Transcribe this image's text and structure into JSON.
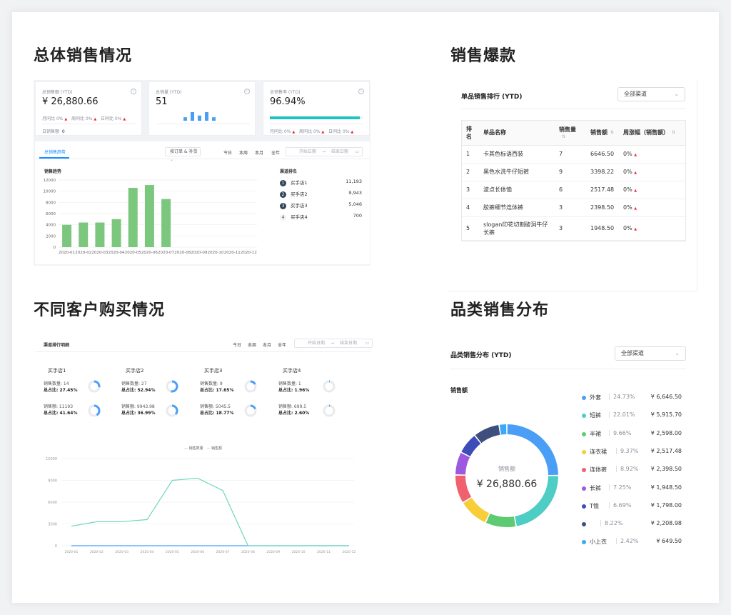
{
  "sections": {
    "overall": "总体销售情况",
    "hot": "销售爆款",
    "customer": "不同客户购买情况",
    "category": "品类销售分布"
  },
  "kpi": [
    {
      "label": "总销售额 (YTD)",
      "value": "¥ 26,880.66",
      "compare": [
        {
          "k": "月同比",
          "v": "0%"
        },
        {
          "k": "周同比",
          "v": "0%"
        },
        {
          "k": "日同比",
          "v": "0%"
        }
      ],
      "footer_label": "日销售额",
      "footer_value": "0"
    },
    {
      "label": "总销量 (YTD)",
      "value": "51",
      "bars": [
        2,
        5,
        3,
        5,
        2
      ],
      "footer_label": "",
      "footer_value": ""
    },
    {
      "label": "总销售率 (YTD)",
      "value": "96.94%",
      "progress": 0.9694,
      "compare": [
        {
          "k": "月同比",
          "v": "0%"
        },
        {
          "k": "周同比",
          "v": "0%"
        },
        {
          "k": "日同比",
          "v": "0%"
        }
      ]
    }
  ],
  "trend_panel": {
    "tab": "总销售趋势",
    "filter": "按订单 & 补货",
    "ranges": [
      "今日",
      "本周",
      "本月",
      "全年"
    ],
    "start_ph": "开始日期",
    "end_ph": "结束日期",
    "chart_title": "销售趋势",
    "ranking_title": "渠道排名",
    "ranking": [
      {
        "rank": "1",
        "name": "买手店1",
        "value": "11,193"
      },
      {
        "rank": "2",
        "name": "买手店2",
        "value": "9,943"
      },
      {
        "rank": "3",
        "name": "买手店3",
        "value": "5,046"
      },
      {
        "rank": "4",
        "name": "买手店4",
        "value": "700"
      }
    ]
  },
  "hot": {
    "title": "单品销售排行 (YTD)",
    "channel": "全部渠道",
    "headers": [
      "排名",
      "单品名称",
      "销售量",
      "销售额",
      "周涨幅（销售额）"
    ],
    "rows": [
      {
        "rank": "1",
        "name": "卡其色标语西装",
        "qty": "7",
        "amount": "6646.50",
        "change": "0%"
      },
      {
        "rank": "2",
        "name": "黑色水洗牛仔短裤",
        "qty": "9",
        "amount": "3398.22",
        "change": "0%"
      },
      {
        "rank": "3",
        "name": "波点长体恤",
        "qty": "6",
        "amount": "2517.48",
        "change": "0%"
      },
      {
        "rank": "4",
        "name": "胶裤细节连体裤",
        "qty": "3",
        "amount": "2398.50",
        "change": "0%"
      },
      {
        "rank": "5",
        "name": "slogan印花切割破洞牛仔长裤",
        "qty": "3",
        "amount": "1948.50",
        "change": "0%"
      }
    ]
  },
  "customer": {
    "title": "渠道排行明细",
    "ranges": [
      "今日",
      "本周",
      "本月",
      "全年"
    ],
    "start_ph": "开始日期",
    "end_ph": "结束日期",
    "stores": [
      {
        "name": "买手店1",
        "qty": "销售数量: 14",
        "qty_share": "总占比: 27.45%",
        "q": 0.2745,
        "amt": "销售额: 11193",
        "amt_share": "总占比: 41.64%",
        "a": 0.4164
      },
      {
        "name": "买手店2",
        "qty": "销售数量: 27",
        "qty_share": "总占比: 52.94%",
        "q": 0.5294,
        "amt": "销售额: 9943.98",
        "amt_share": "总占比: 36.99%",
        "a": 0.3699
      },
      {
        "name": "买手店3",
        "qty": "销售数量: 9",
        "qty_share": "总占比: 17.65%",
        "q": 0.1765,
        "amt": "销售额: 5045.5",
        "amt_share": "总占比: 18.77%",
        "a": 0.1877
      },
      {
        "name": "买手店4",
        "qty": "销售数量: 1",
        "qty_share": "总占比: 1.96%",
        "q": 0.0196,
        "amt": "销售额: 699.5",
        "amt_share": "总占比: 2.60%",
        "a": 0.026
      }
    ],
    "legend": [
      "销售数量",
      "销售额"
    ]
  },
  "category": {
    "title": "品类销售分布 (YTD)",
    "channel": "全部渠道",
    "chart_label": "销售额",
    "center_label": "销售额",
    "center_value": "¥ 26,880.66",
    "items": [
      {
        "name": "外套",
        "pct": "24.73%",
        "value": "¥ 6,646.50",
        "color": "#4b9ef5"
      },
      {
        "name": "短裤",
        "pct": "22.01%",
        "value": "¥ 5,915.70",
        "color": "#4ecdc4"
      },
      {
        "name": "半裙",
        "pct": "9.66%",
        "value": "¥ 2,598.00",
        "color": "#5ecb72"
      },
      {
        "name": "连衣裙",
        "pct": "9.37%",
        "value": "¥ 2,517.48",
        "color": "#f7cd3a"
      },
      {
        "name": "连体裤",
        "pct": "8.92%",
        "value": "¥ 2,398.50",
        "color": "#f0606e"
      },
      {
        "name": "长裤",
        "pct": "7.25%",
        "value": "¥ 1,948.50",
        "color": "#9b59e0"
      },
      {
        "name": "T恤",
        "pct": "6.69%",
        "value": "¥ 1,798.00",
        "color": "#3d4db7"
      },
      {
        "name": "",
        "pct": "8.22%",
        "value": "¥ 2,208.98",
        "color": "#3e4f7e"
      },
      {
        "name": "小上衣",
        "pct": "2.42%",
        "value": "¥ 649.50",
        "color": "#3ba9f5"
      }
    ]
  },
  "chart_data": [
    {
      "type": "bar",
      "title": "销售趋势",
      "categories": [
        "2020-01",
        "2020-02",
        "2020-03",
        "2020-04",
        "2020-05",
        "2020-06",
        "2020-07",
        "2020-08",
        "2020-09",
        "2020-10",
        "2020-11",
        "2020-12"
      ],
      "values": [
        4000,
        4400,
        4400,
        5000,
        10600,
        11100,
        8600,
        0,
        0,
        0,
        0,
        0
      ],
      "ylim": [
        0,
        12000
      ],
      "yticks": [
        0,
        2000,
        4000,
        6000,
        8000,
        10000,
        12000
      ],
      "color": "#7ac77d"
    },
    {
      "type": "line",
      "categories": [
        "2020-01",
        "2020-02",
        "2020-03",
        "2020-04",
        "2020-05",
        "2020-06",
        "2020-07",
        "2020-08",
        "2020-09",
        "2020-10",
        "2020-11",
        "2020-12"
      ],
      "series": [
        {
          "name": "销售数量",
          "values": [
            0,
            0,
            0,
            0,
            0,
            0,
            0,
            0,
            0,
            0,
            0,
            0
          ],
          "color": "#4b9ef5"
        },
        {
          "name": "销售额",
          "values": [
            2700,
            3300,
            3300,
            3600,
            9000,
            9300,
            7600,
            0,
            0,
            0,
            0,
            0
          ],
          "color": "#6fd6c0"
        }
      ],
      "ylim": [
        0,
        12000
      ],
      "yticks": [
        0,
        3000,
        6000,
        9000,
        12000
      ]
    },
    {
      "type": "pie",
      "labels": [
        "外套",
        "短裤",
        "半裙",
        "连衣裙",
        "连体裤",
        "长裤",
        "T恤",
        "",
        "小上衣"
      ],
      "values": [
        24.73,
        22.01,
        9.66,
        9.37,
        8.92,
        7.25,
        6.69,
        8.22,
        2.42
      ]
    }
  ]
}
